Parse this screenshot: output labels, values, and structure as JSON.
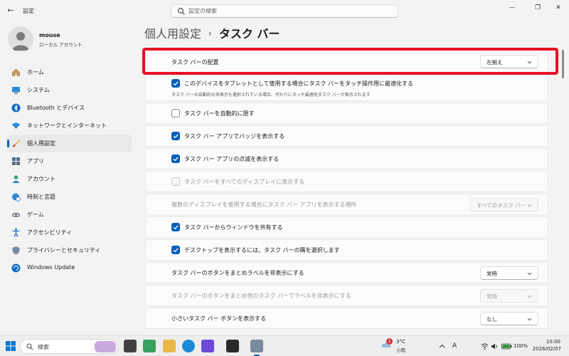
{
  "window": {
    "back_glyph": "←",
    "title": "設定",
    "controls": {
      "minimize": "—",
      "maximize": "❐",
      "close": "✕"
    }
  },
  "search": {
    "placeholder": "設定の検索"
  },
  "user": {
    "name": "mouse",
    "account_type": "ローカル アカウント"
  },
  "sidebar": {
    "items": [
      {
        "label": "ホーム",
        "icon": "home-icon"
      },
      {
        "label": "システム",
        "icon": "monitor-icon"
      },
      {
        "label": "Bluetooth とデバイス",
        "icon": "bluetooth-icon"
      },
      {
        "label": "ネットワークとインターネット",
        "icon": "wifi-icon"
      },
      {
        "label": "個人用設定",
        "icon": "brush-icon",
        "active": true
      },
      {
        "label": "アプリ",
        "icon": "apps-icon"
      },
      {
        "label": "アカウント",
        "icon": "account-icon"
      },
      {
        "label": "時刻と言語",
        "icon": "globe-clock-icon"
      },
      {
        "label": "ゲーム",
        "icon": "gamepad-icon"
      },
      {
        "label": "アクセシビリティ",
        "icon": "accessibility-icon"
      },
      {
        "label": "プライバシーとセキュリティ",
        "icon": "shield-icon"
      },
      {
        "label": "Windows Update",
        "icon": "update-icon"
      }
    ]
  },
  "breadcrumb": {
    "parent": "個人用設定",
    "separator": "›",
    "current": "タスク バー"
  },
  "settings": {
    "alignment": {
      "label": "タスク バーの配置",
      "value": "左揃え"
    },
    "tablet": {
      "label": "このデバイスをタブレットとして使用する場合にタスク バーをタッチ操作用に最適化する",
      "description": "タスク バーの自動的な非表示も選択されている場合、代わりにタッチ最適化タスク バーが表示されます",
      "checked": true
    },
    "auto_hide": {
      "label": "タスク バーを自動的に隠す",
      "checked": false
    },
    "badges": {
      "label": "タスク バー アプリでバッジを表示する",
      "checked": true
    },
    "flashing": {
      "label": "タスク バー アプリの点滅を表示する",
      "checked": true
    },
    "all_displays": {
      "label": "タスク バーをすべてのディスプレイに表示する",
      "checked": false,
      "disabled": true
    },
    "multi_display": {
      "label": "複数のディスプレイを使用する場合にタスク バー アプリを表示する場所",
      "value": "すべてのタスク バー",
      "disabled": true
    },
    "share_window": {
      "label": "タスク バーからウィンドウを共有する",
      "checked": true
    },
    "desktop_corner": {
      "label": "デスクトップを表示するには、タスク バーの隅を選択します",
      "checked": true
    },
    "combine": {
      "label": "タスク バーのボタンをまとめラベルを非表示にする",
      "value": "常時"
    },
    "combine_other": {
      "label": "タスク バーのボタンをまとめ他のタスク バーでラベルを非表示にする",
      "value": "常時",
      "disabled": true
    },
    "small_buttons": {
      "label": "小さいタスク バー ボタンを表示する",
      "value": "なし"
    }
  },
  "taskbar": {
    "search_text": "検索",
    "weather": {
      "badge": "1",
      "temp": "3°C",
      "desc": "小雨"
    },
    "ime": "A",
    "battery": "100%",
    "time": "10:00",
    "date": "2026/02/07"
  },
  "colors": {
    "accent": "#005fb8",
    "highlight": "#e81123"
  }
}
